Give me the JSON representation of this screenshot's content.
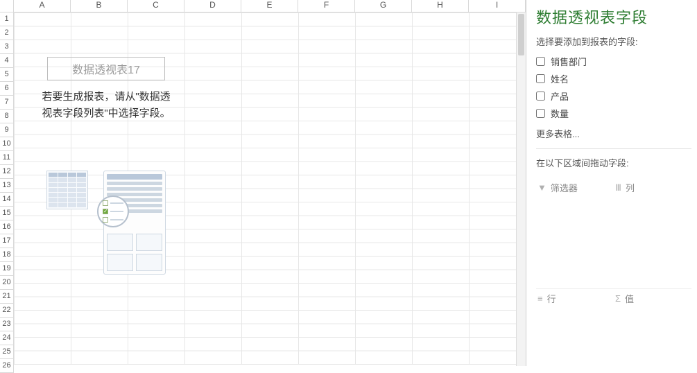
{
  "columns": [
    "A",
    "B",
    "C",
    "D",
    "E",
    "F",
    "G",
    "H",
    "I"
  ],
  "row_start": 1,
  "row_end": 26,
  "pivot_placeholder": {
    "title": "数据透视表17",
    "line1": "若要生成报表，请从\"数据透",
    "line2": "视表字段列表\"中选择字段。"
  },
  "pane": {
    "title": "数据透视表字段",
    "choose_label": "选择要添加到报表的字段:",
    "fields": [
      {
        "label": "销售部门",
        "checked": false
      },
      {
        "label": "姓名",
        "checked": false
      },
      {
        "label": "产品",
        "checked": false
      },
      {
        "label": "数量",
        "checked": false
      }
    ],
    "more_tables": "更多表格...",
    "drag_label": "在以下区域间拖动字段:",
    "zones": {
      "filters": {
        "icon": "▼",
        "label": "筛选器"
      },
      "columns": {
        "icon": "Ⅲ",
        "label": "列"
      },
      "rows": {
        "icon": "≡",
        "label": "行"
      },
      "values": {
        "icon": "Σ",
        "label": "值"
      }
    }
  }
}
